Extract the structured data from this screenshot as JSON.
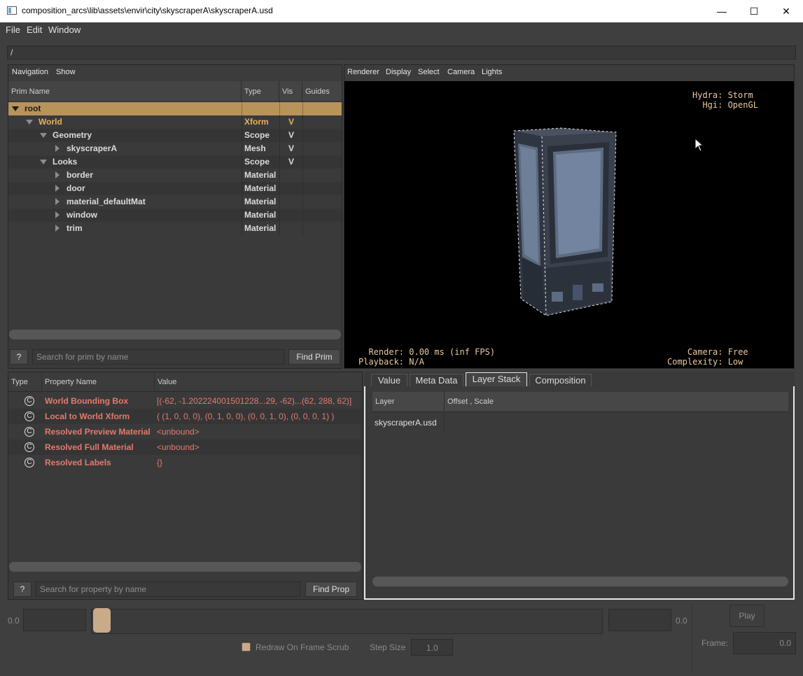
{
  "window": {
    "title": "composition_arcs\\lib\\assets\\envir\\city\\skyscraperA\\skyscraperA.usd",
    "minimize": "—",
    "maximize": "☐",
    "close": "✕"
  },
  "menu": [
    "File",
    "Edit",
    "Window"
  ],
  "path": "/",
  "outliner": {
    "menus": [
      "Navigation",
      "Show"
    ],
    "columns": [
      "Prim Name",
      "Type",
      "Vis",
      "Guides"
    ],
    "rows": [
      {
        "name": "root",
        "type": "",
        "vis": ""
      },
      {
        "name": "World",
        "type": "Xform",
        "vis": "V"
      },
      {
        "name": "Geometry",
        "type": "Scope",
        "vis": "V"
      },
      {
        "name": "skyscraperA",
        "type": "Mesh",
        "vis": "V"
      },
      {
        "name": "Looks",
        "type": "Scope",
        "vis": "V"
      },
      {
        "name": "border",
        "type": "Material",
        "vis": ""
      },
      {
        "name": "door",
        "type": "Material",
        "vis": ""
      },
      {
        "name": "material_defaultMat",
        "type": "Material",
        "vis": ""
      },
      {
        "name": "window",
        "type": "Material",
        "vis": ""
      },
      {
        "name": "trim",
        "type": "Material",
        "vis": ""
      }
    ],
    "help_label": "?",
    "search_placeholder": "Search for prim by name",
    "find_button": "Find Prim"
  },
  "viewport": {
    "menus": [
      "Renderer",
      "Display",
      "Select",
      "Camera",
      "Lights"
    ],
    "hud_top_right": "Hydra: Storm\n  Hgi: OpenGL",
    "hud_bottom_left": "  Render: 0.00 ms (inf FPS)\nPlayback: N/A",
    "hud_bottom_right": "    Camera: Free\nComplexity: Low"
  },
  "properties": {
    "columns": [
      "Type",
      "Property Name",
      "Value"
    ],
    "rows": [
      {
        "icon": "C",
        "name": "World Bounding Box",
        "value": "[(-62, -1.202224001501228...29, -62)...(62, 288, 62)]"
      },
      {
        "icon": "C",
        "name": "Local to World Xform",
        "value": "( (1, 0, 0, 0), (0, 1, 0, 0), (0, 0, 1, 0), (0, 0, 0, 1) )"
      },
      {
        "icon": "C",
        "name": "Resolved Preview Material",
        "value": "<unbound>"
      },
      {
        "icon": "C",
        "name": "Resolved Full Material",
        "value": "<unbound>"
      },
      {
        "icon": "C",
        "name": "Resolved Labels",
        "value": "{}"
      }
    ],
    "help_label": "?",
    "search_placeholder": "Search for property by name",
    "find_button": "Find Prop"
  },
  "layer_panel": {
    "tabs": [
      "Value",
      "Meta Data",
      "Layer Stack",
      "Composition"
    ],
    "active_tab": "Layer Stack",
    "columns": [
      "Layer",
      "Offset , Scale"
    ],
    "rows": [
      {
        "layer": "skyscraperA.usd",
        "offset": ""
      }
    ]
  },
  "timeline": {
    "start": "0.0",
    "end": "0.0",
    "play_button": "Play",
    "frame_label": "Frame:",
    "frame_value": "0.0",
    "redraw_label": "Redraw On Frame Scrub",
    "step_label": "Step Size",
    "step_value": "1.0"
  },
  "colors": {
    "selected_row": "#b8935a",
    "world_text": "#e6b15a",
    "prop_text": "#e47a6e",
    "hud": "#e8c9a0"
  }
}
